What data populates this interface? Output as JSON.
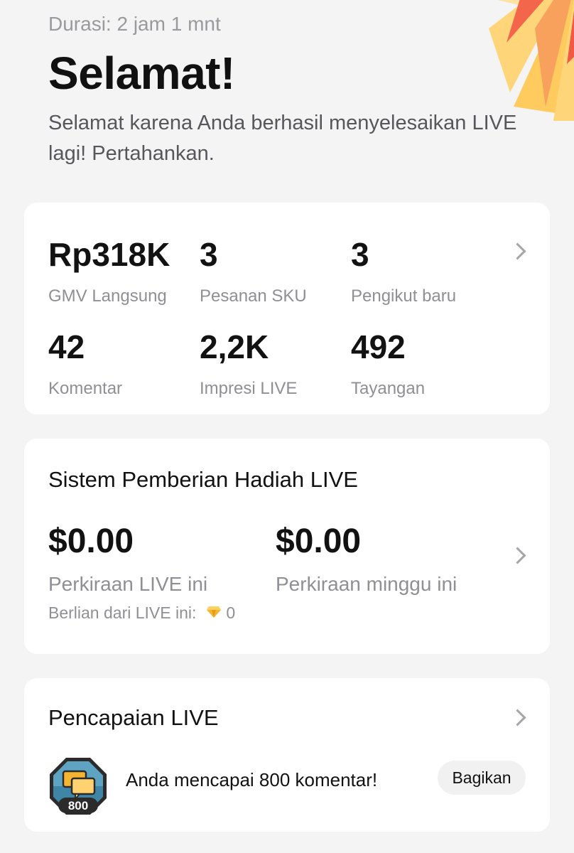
{
  "header": {
    "duration": "Durasi: 2 jam 1 mnt",
    "title": "Selamat!",
    "subtitle": "Selamat karena Anda berhasil menyelesaikan LIVE lagi! Pertahankan."
  },
  "stats": [
    {
      "value": "Rp318K",
      "label": "GMV Langsung"
    },
    {
      "value": "3",
      "label": "Pesanan SKU"
    },
    {
      "value": "3",
      "label": "Pengikut baru"
    },
    {
      "value": "42",
      "label": "Komentar"
    },
    {
      "value": "2,2K",
      "label": "Impresi LIVE"
    },
    {
      "value": "492",
      "label": "Tayangan"
    }
  ],
  "gifts": {
    "title": "Sistem Pemberian Hadiah LIVE",
    "live_value": "$0.00",
    "live_label": "Perkiraan LIVE ini",
    "week_value": "$0.00",
    "week_label": "Perkiraan minggu ini",
    "diamonds_label": "Berlian dari LIVE ini:",
    "diamonds_count": "0"
  },
  "achievements": {
    "title": "Pencapaian LIVE",
    "badge_number": "800",
    "text": "Anda mencapai 800 komentar!",
    "share_label": "Bagikan"
  },
  "colors": {
    "background": "#f4f4f5",
    "card": "#ffffff",
    "burst_yellow": "#ffd271",
    "burst_red": "#f25a45",
    "diamond": "#f5b533",
    "badge_blue": "#2e6f8e"
  }
}
